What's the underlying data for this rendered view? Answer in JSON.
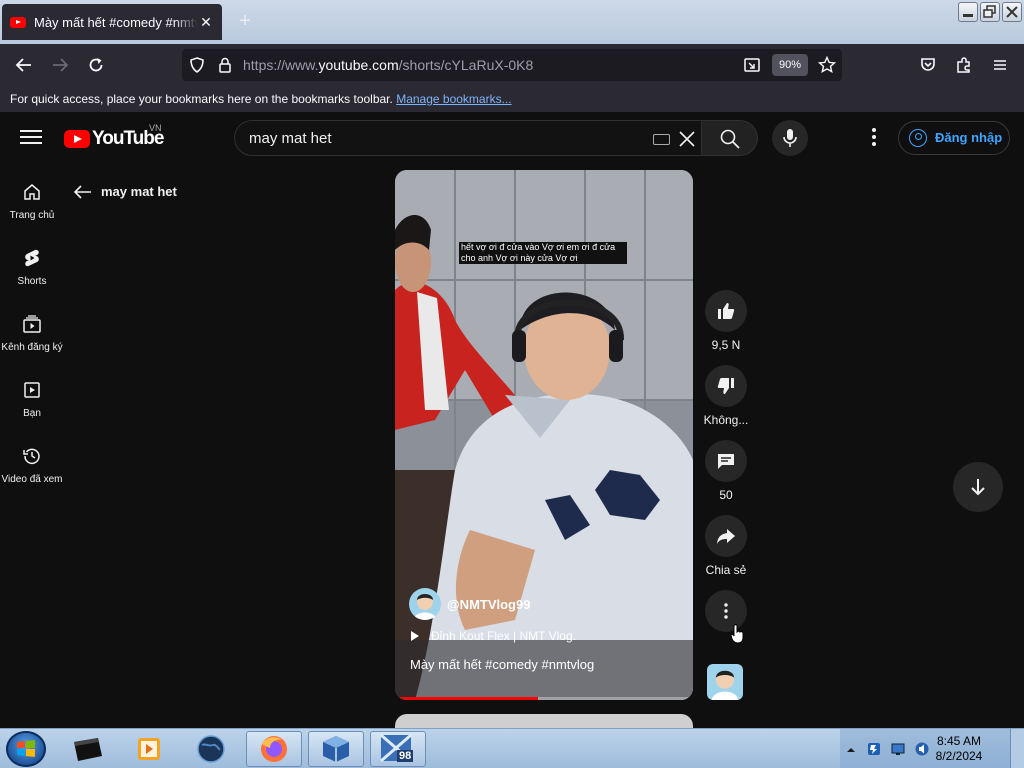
{
  "browser": {
    "tab_title": "Mày mất hết #comedy #nmtvlog",
    "tab_close": "✕",
    "new_tab": "+",
    "url_prefix": "https://www.",
    "url_host": "youtube.com",
    "url_path": "/shorts/cYLaRuX-0K8",
    "zoom": "90%",
    "bookmarks_text": "For quick access, place your bookmarks here on the bookmarks toolbar.",
    "bookmarks_link": "Manage bookmarks..."
  },
  "youtube": {
    "logo_text": "YouTube",
    "country_code": "VN",
    "search_value": "may mat het",
    "sign_in_label": "Đăng nhập",
    "accent_color": "#3ea6ff",
    "guide": [
      {
        "label": "Trang chủ",
        "icon": "home-icon"
      },
      {
        "label": "Shorts",
        "icon": "shorts-icon"
      },
      {
        "label": "Kênh đăng ký",
        "icon": "subscriptions-icon"
      },
      {
        "label": "Bạn",
        "icon": "you-icon"
      },
      {
        "label": "Video đã xem",
        "icon": "history-icon"
      }
    ],
    "back_label": "may mat het",
    "short": {
      "caption": "hết vợ ơi đ cửa vào Vợ ơi em ơi đ cửa cho anh Vợ ơi này cửa Vợ ơi",
      "channel": "@NMTVlog99",
      "music": "Đỉnh Kout Flex | NMT Vlog.",
      "title": "Mày mất hết #comedy #nmtvlog",
      "progress": 0.48
    },
    "actions": {
      "likes": "9,5 N",
      "dislike": "Không...",
      "comments": "50",
      "share": "Chia sẻ"
    }
  },
  "taskbar": {
    "time": "8:45 AM",
    "date": "8/2/2024",
    "vbox_badge": "98"
  }
}
